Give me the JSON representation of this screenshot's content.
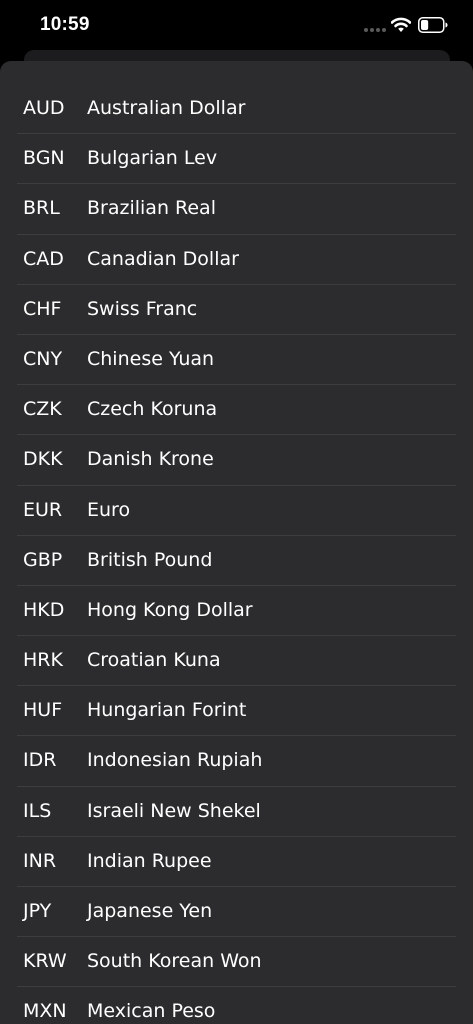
{
  "status_bar": {
    "time": "10:59",
    "icons": [
      "signal-dots-icon",
      "wifi-icon",
      "battery-icon"
    ],
    "battery_level": 0.35
  },
  "colors": {
    "background": "#000000",
    "sheet": "#2c2c2e",
    "text": "#ffffff",
    "separator": "#3d3d40"
  },
  "currencies": [
    {
      "code": "AUD",
      "name": "Australian Dollar"
    },
    {
      "code": "BGN",
      "name": "Bulgarian Lev"
    },
    {
      "code": "BRL",
      "name": "Brazilian Real"
    },
    {
      "code": "CAD",
      "name": "Canadian Dollar"
    },
    {
      "code": "CHF",
      "name": "Swiss Franc"
    },
    {
      "code": "CNY",
      "name": "Chinese Yuan"
    },
    {
      "code": "CZK",
      "name": "Czech Koruna"
    },
    {
      "code": "DKK",
      "name": "Danish Krone"
    },
    {
      "code": "EUR",
      "name": "Euro"
    },
    {
      "code": "GBP",
      "name": "British Pound"
    },
    {
      "code": "HKD",
      "name": "Hong Kong Dollar"
    },
    {
      "code": "HRK",
      "name": "Croatian Kuna"
    },
    {
      "code": "HUF",
      "name": "Hungarian Forint"
    },
    {
      "code": "IDR",
      "name": "Indonesian Rupiah"
    },
    {
      "code": "ILS",
      "name": "Israeli New Shekel"
    },
    {
      "code": "INR",
      "name": "Indian Rupee"
    },
    {
      "code": "JPY",
      "name": "Japanese Yen"
    },
    {
      "code": "KRW",
      "name": "South Korean Won"
    },
    {
      "code": "MXN",
      "name": "Mexican Peso"
    }
  ]
}
